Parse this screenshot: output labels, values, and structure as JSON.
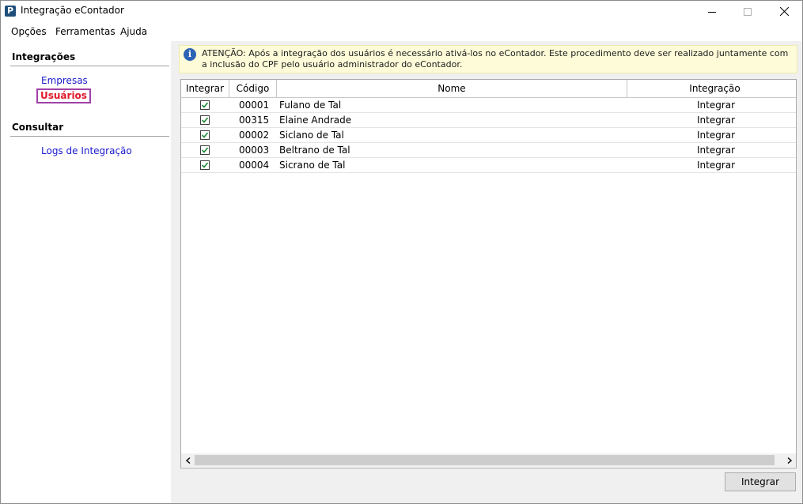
{
  "window": {
    "title": "Integração eContador",
    "app_icon_letter": "P"
  },
  "menu": {
    "items": [
      "Opções",
      "Ferramentas",
      "Ajuda"
    ]
  },
  "sidebar": {
    "section1_title": "Integrações",
    "section1_items": [
      "Empresas",
      "Usuários"
    ],
    "active_item": "Usuários",
    "section2_title": "Consultar",
    "section2_items": [
      "Logs de Integração"
    ]
  },
  "notice": {
    "icon": "info-icon",
    "text": "ATENÇÃO: Após a integração dos usuários é necessário ativá-los no eContador. Este procedimento deve ser realizado juntamente com a inclusão do CPF pelo usuário administrador do eContador."
  },
  "grid": {
    "columns": [
      "Integrar",
      "Código",
      "Nome",
      "Integração"
    ],
    "rows": [
      {
        "checked": true,
        "codigo": "00001",
        "nome": "Fulano de Tal",
        "integracao": "Integrar"
      },
      {
        "checked": true,
        "codigo": "00315",
        "nome": "Elaine Andrade",
        "integracao": "Integrar"
      },
      {
        "checked": true,
        "codigo": "00002",
        "nome": "Siclano de Tal",
        "integracao": "Integrar"
      },
      {
        "checked": true,
        "codigo": "00003",
        "nome": "Beltrano de Tal",
        "integracao": "Integrar"
      },
      {
        "checked": true,
        "codigo": "00004",
        "nome": "Sicrano de Tal",
        "integracao": "Integrar"
      }
    ]
  },
  "actions": {
    "integrar_button": "Integrar"
  },
  "colors": {
    "link": "#1a1acc",
    "active_link": "#e0192b",
    "active_border": "#a040a8",
    "notice_bg": "#fdfbd8",
    "check": "#1e8a3a"
  }
}
